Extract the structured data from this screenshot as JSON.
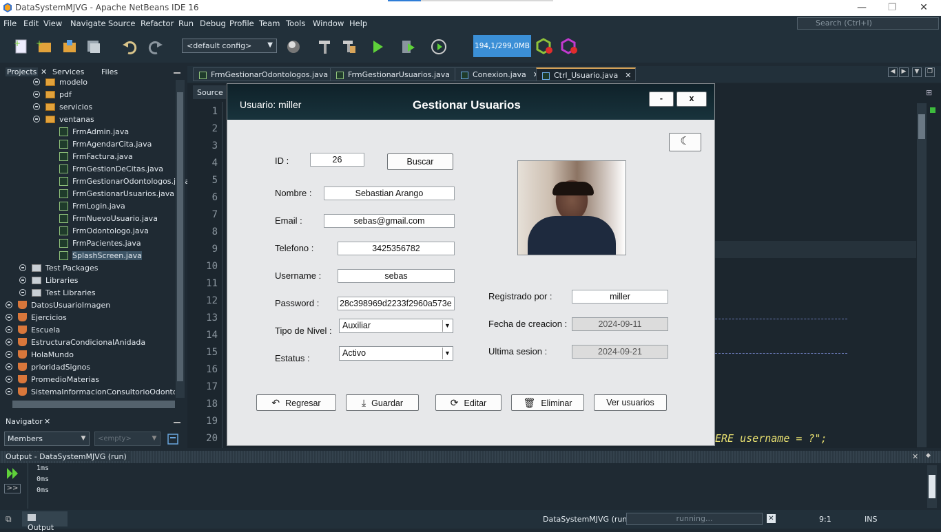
{
  "window": {
    "title": "DataSystemMJVG - Apache NetBeans IDE 16",
    "minimize": "—",
    "restore": "❐",
    "close": "✕"
  },
  "menu": [
    "File",
    "Edit",
    "View",
    "Navigate",
    "Source",
    "Refactor",
    "Run",
    "Debug",
    "Profile",
    "Team",
    "Tools",
    "Window",
    "Help"
  ],
  "search": {
    "placeholder": "Search (Ctrl+I)"
  },
  "toolbar": {
    "config": "<default config>",
    "memory": "194,1/299,0MB"
  },
  "left_tabs": [
    "Projects",
    "Services",
    "Files"
  ],
  "tree": {
    "packages": [
      "modelo",
      "pdf",
      "servicios",
      "ventanas"
    ],
    "files": [
      "FrmAdmin.java",
      "FrmAgendarCita.java",
      "FrmFactura.java",
      "FrmGestionDeCitas.java",
      "FrmGestionarOdontologos.java",
      "FrmGestionarUsuarios.java",
      "FrmLogin.java",
      "FrmNuevoUsuario.java",
      "FrmOdontologo.java",
      "FrmPacientes.java",
      "SplashScreen.java"
    ],
    "nodes": [
      "Test Packages",
      "Libraries",
      "Test Libraries"
    ],
    "projects": [
      "DatosUsuarioImagen",
      "Ejercicios",
      "Escuela",
      "EstructuraCondicionalAnidada",
      "HolaMundo",
      "prioridadSignos",
      "PromedioMaterias",
      "SistemaInformacionConsultorioOdontologico"
    ]
  },
  "navigator": {
    "title": "Navigator",
    "members": "Members",
    "empty": "<empty>"
  },
  "editor_tabs": [
    "FrmGestionarOdontologos.java",
    "FrmGestionarUsuarios.java",
    "Conexion.java",
    "Ctrl_Usuario.java"
  ],
  "editor": {
    "source_tab": "Source",
    "lines": [
      "1",
      "2",
      "3",
      "4",
      "5",
      "6",
      "7",
      "8",
      "9",
      "10",
      "11",
      "12",
      "13",
      "14",
      "15",
      "16",
      "17",
      "18",
      "19",
      "20"
    ],
    "code_fragment": "ERE username = ?\";"
  },
  "output": {
    "title": "Output - DataSystemMJVG (run)",
    "lines": [
      "1ms",
      "0ms",
      "0ms"
    ]
  },
  "status": {
    "output_tab": "Output",
    "project": "DataSystemMJVG (run)",
    "progress": "running...",
    "position": "9:1",
    "mode": "INS"
  },
  "dialog": {
    "user_label": "Usuario: miller",
    "title": "Gestionar Usuarios",
    "min": "-",
    "close": "x",
    "labels": {
      "id": "ID :",
      "nombre": "Nombre :",
      "email": "Email :",
      "telefono": "Telefono :",
      "username": "Username :",
      "password": "Password :",
      "nivel": "Tipo de Nivel :",
      "estatus": "Estatus :",
      "registrado": "Registrado por :",
      "fecha": "Fecha de creacion :",
      "ultima": "Ultima sesion :"
    },
    "values": {
      "id": "26",
      "nombre": "Sebastian Arango",
      "email": "sebas@gmail.com",
      "telefono": "3425356782",
      "username": "sebas",
      "password": "28c398969d2233f2960a573e",
      "nivel": "Auxiliar",
      "estatus": "Activo",
      "registrado": "miller",
      "fecha": "2024-09-11",
      "ultima": "2024-09-21"
    },
    "buttons": {
      "buscar": "Buscar",
      "regresar": "Regresar",
      "guardar": "Guardar",
      "editar": "Editar",
      "eliminar": "Eliminar",
      "ver": "Ver usuarios"
    },
    "icons": {
      "theme": "moon-icon"
    }
  }
}
